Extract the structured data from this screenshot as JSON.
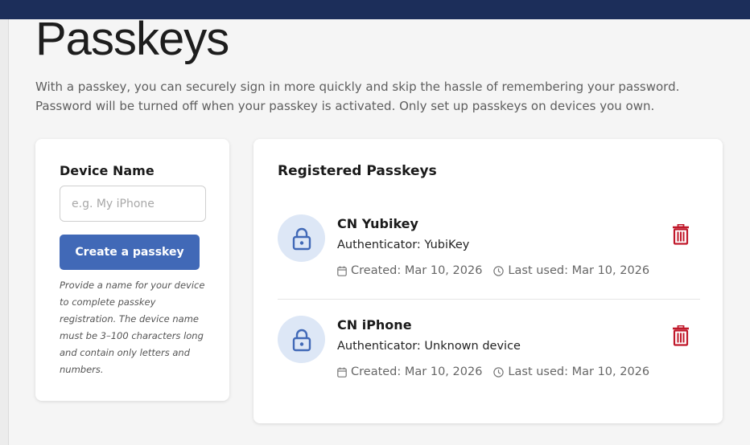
{
  "page": {
    "title": "Passkeys",
    "description": "With a passkey, you can securely sign in more quickly and skip the hassle of remembering your password. Password will be turned off when your passkey is activated. Only set up passkeys on devices you own."
  },
  "form": {
    "device_label": "Device Name",
    "device_placeholder": "e.g. My iPhone",
    "device_value": "",
    "create_button": "Create a passkey",
    "hint": "Provide a name for your device to complete passkey registration. The device name must be 3–100 characters long and contain only letters and numbers."
  },
  "registered": {
    "title": "Registered Passkeys",
    "items": [
      {
        "name": "CN Yubikey",
        "authenticator": "Authenticator: YubiKey",
        "created": "Created: Mar 10, 2026",
        "last_used": "Last used: Mar 10, 2026"
      },
      {
        "name": "CN iPhone",
        "authenticator": "Authenticator: Unknown device",
        "created": "Created: Mar 10, 2026",
        "last_used": "Last used: Mar 10, 2026"
      }
    ]
  },
  "icons": {
    "lock": "lock-icon",
    "calendar": "calendar-icon",
    "clock": "clock-icon",
    "trash": "trash-icon"
  },
  "colors": {
    "header": "#1c2e5a",
    "primary": "#4169b7",
    "danger": "#c0182a",
    "avatar_bg": "#dde7f6"
  }
}
